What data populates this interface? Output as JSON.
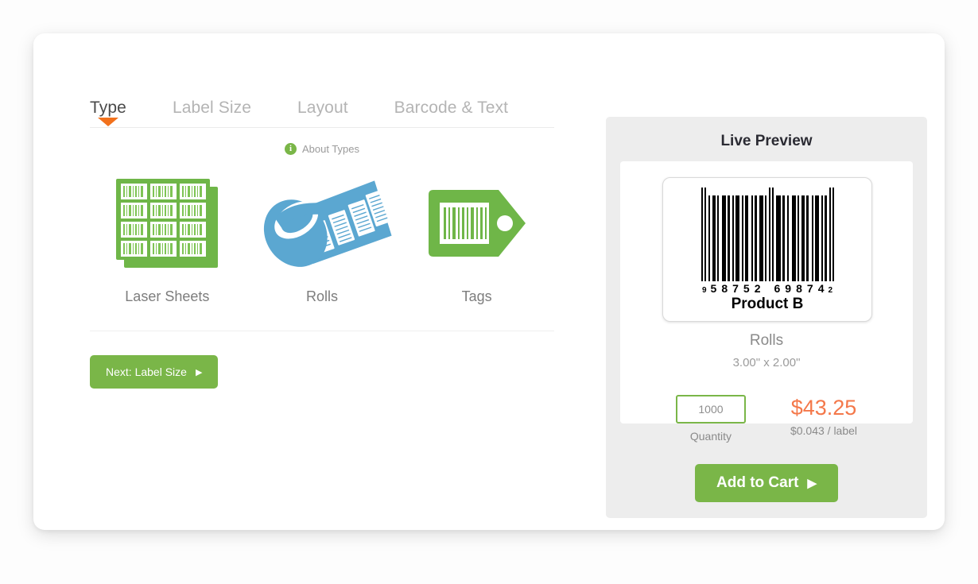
{
  "tabs": [
    {
      "label": "Type",
      "active": true
    },
    {
      "label": "Label Size",
      "active": false
    },
    {
      "label": "Layout",
      "active": false
    },
    {
      "label": "Barcode & Text",
      "active": false
    }
  ],
  "about": {
    "icon": "info-icon",
    "label": "About Types"
  },
  "types": [
    {
      "label": "Laser Sheets",
      "icon": "laser-sheets-icon",
      "color": "#6fb648"
    },
    {
      "label": "Rolls",
      "icon": "rolls-icon",
      "color": "#5ba7d1"
    },
    {
      "label": "Tags",
      "icon": "tags-icon",
      "color": "#6fb648"
    }
  ],
  "next_button": {
    "label": "Next: Label Size",
    "arrow": "▶",
    "color": "#7ab648"
  },
  "preview": {
    "title": "Live Preview",
    "barcode": {
      "lead_digit": "9",
      "left_group": [
        "5",
        "8",
        "7",
        "5",
        "2"
      ],
      "right_group": [
        "6",
        "9",
        "8",
        "7",
        "4"
      ],
      "trail_digit": "2",
      "full_number": "9 58752 69874 2"
    },
    "product_name": "Product B",
    "label_type": "Rolls",
    "dimensions": "3.00\" x 2.00\"",
    "quantity": {
      "value": "1000",
      "placeholder": "1000",
      "caption": "Quantity"
    },
    "pricing": {
      "total": "$43.25",
      "unit": "$0.043 / label",
      "accent_color": "#f4784a"
    },
    "add_to_cart": {
      "label": "Add to Cart",
      "arrow": "▶",
      "color": "#7ab648"
    }
  }
}
